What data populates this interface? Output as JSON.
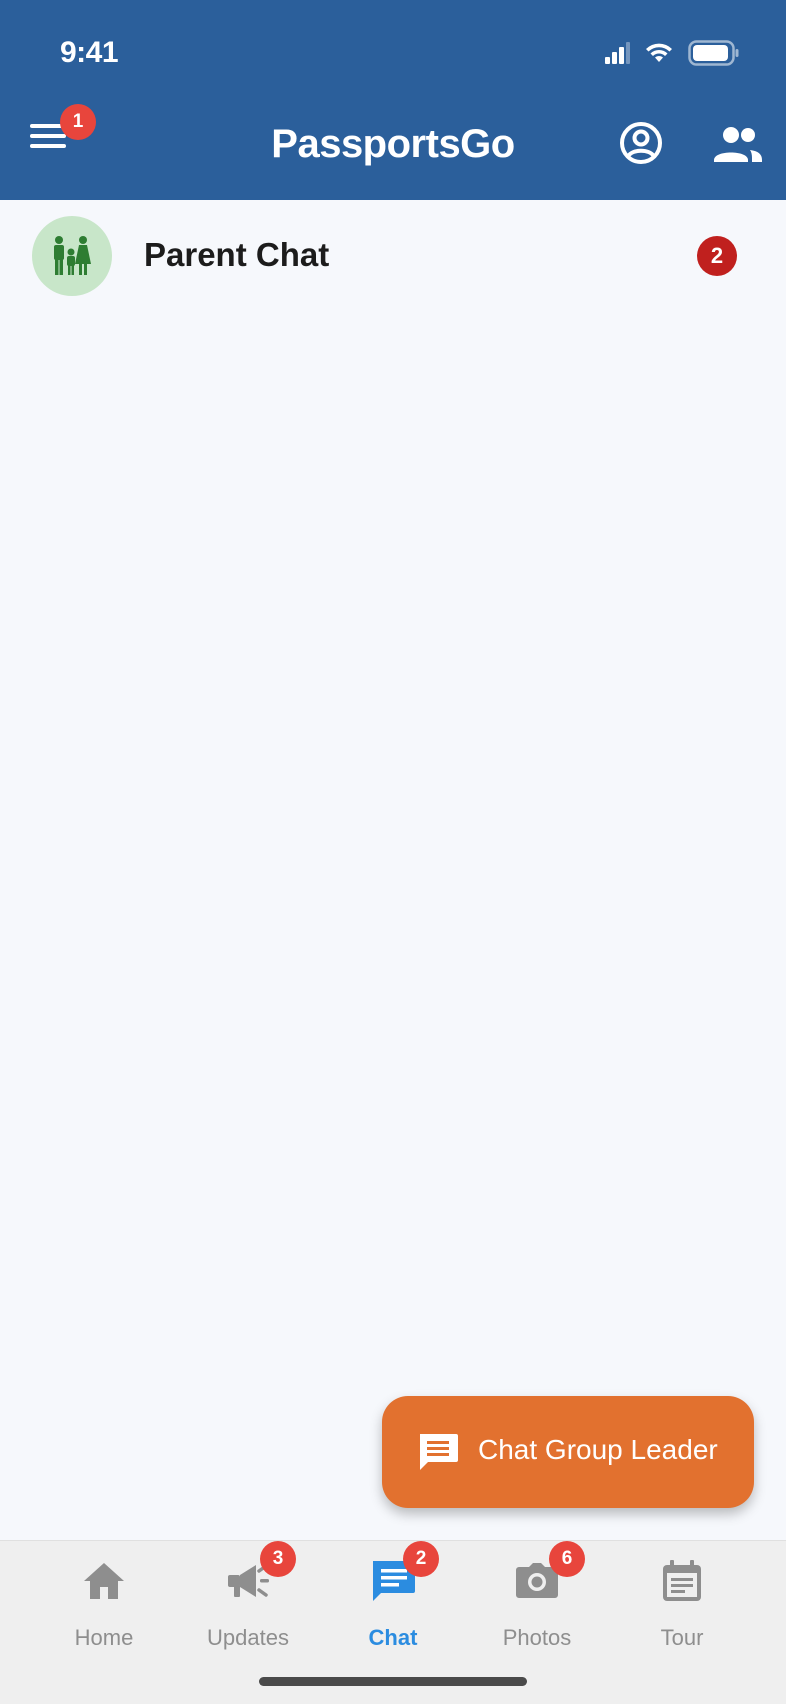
{
  "status_bar": {
    "time": "9:41"
  },
  "header": {
    "title": "PassportsGo",
    "menu_badge": "1",
    "background_color": "#2b5f9b"
  },
  "chats": [
    {
      "name": "Parent Chat",
      "unread": "2",
      "icon": "family-icon"
    }
  ],
  "fab": {
    "label": "Chat Group Leader",
    "icon": "chat-icon",
    "color": "#e2712f"
  },
  "bottom_nav": {
    "items": [
      {
        "label": "Home",
        "icon": "home-icon",
        "badge": ""
      },
      {
        "label": "Updates",
        "icon": "megaphone-icon",
        "badge": "3"
      },
      {
        "label": "Chat",
        "icon": "chat-icon",
        "badge": "2",
        "active": true
      },
      {
        "label": "Photos",
        "icon": "camera-icon",
        "badge": "6"
      },
      {
        "label": "Tour",
        "icon": "calendar-icon",
        "badge": ""
      }
    ],
    "active_color": "#2b8ce0"
  }
}
